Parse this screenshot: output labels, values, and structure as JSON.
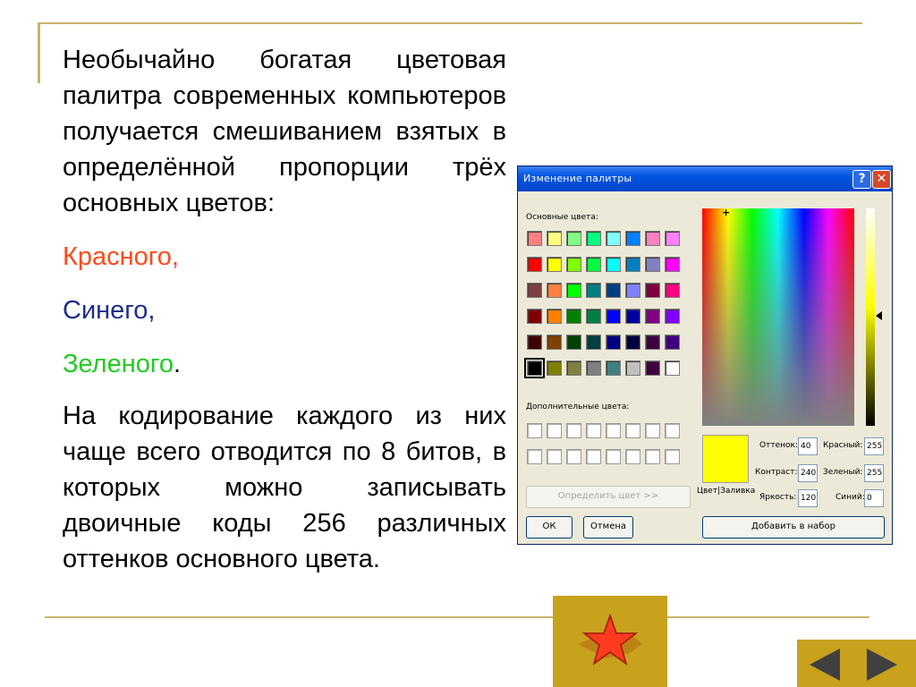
{
  "slide": {
    "paragraph_intro": "Необычайно богатая цветовая палитра современных компьютеров получается смешиванием взятых в определённой пропорции трёх основных цветов:",
    "color_red": "Красного,",
    "color_blue": "Синего,",
    "color_green": "Зеленого",
    "color_green_period": ".",
    "paragraph_coding": "На кодирование каждого из них чаще всего отводится по 8 битов, в которых можно записывать двоичные коды 256 различных оттенков основного цвета."
  },
  "dialog": {
    "title": "Изменение палитры",
    "help_symbol": "?",
    "close_symbol": "✕",
    "basic_colors_label": "Основные цвета:",
    "custom_colors_label": "Дополнительные цвета:",
    "define_button": "Определить цвет >>",
    "ok_button": "ОК",
    "cancel_button": "Отмена",
    "add_button": "Добавить в набор",
    "color_fill_label": "Цвет|Заливка",
    "fields": {
      "hue_label": "Оттенок:",
      "hue_value": "40",
      "sat_label": "Контраст:",
      "sat_value": "240",
      "lum_label": "Яркость:",
      "lum_value": "120",
      "red_label": "Красный:",
      "red_value": "255",
      "green_label": "Зеленый:",
      "green_value": "255",
      "blue_label": "Синий:",
      "blue_value": "0"
    },
    "basic_colors": [
      [
        "#ff8080",
        "#ffff80",
        "#80ff80",
        "#00ff80",
        "#80ffff",
        "#0080ff",
        "#ff80c0",
        "#ff80ff"
      ],
      [
        "#ff0000",
        "#ffff00",
        "#80ff00",
        "#00ff40",
        "#00ffff",
        "#0080c0",
        "#8080c0",
        "#ff00ff"
      ],
      [
        "#804040",
        "#ff8040",
        "#00ff00",
        "#008080",
        "#004080",
        "#8080ff",
        "#800040",
        "#ff0080"
      ],
      [
        "#800000",
        "#ff8000",
        "#008000",
        "#008040",
        "#0000ff",
        "#0000a0",
        "#800080",
        "#8000ff"
      ],
      [
        "#400000",
        "#804000",
        "#004000",
        "#004040",
        "#000080",
        "#000040",
        "#400040",
        "#400080"
      ],
      [
        "#000000",
        "#808000",
        "#808040",
        "#808080",
        "#408080",
        "#c0c0c0",
        "#400040",
        "#ffffff"
      ]
    ],
    "selected_swatch": "5-0",
    "preview_color": "#ffff00"
  },
  "nav": {
    "accent": "#c8a11d",
    "star_color": "#ff3b1f",
    "back_icon": "triangle-left",
    "forward_icon": "triangle-right"
  }
}
